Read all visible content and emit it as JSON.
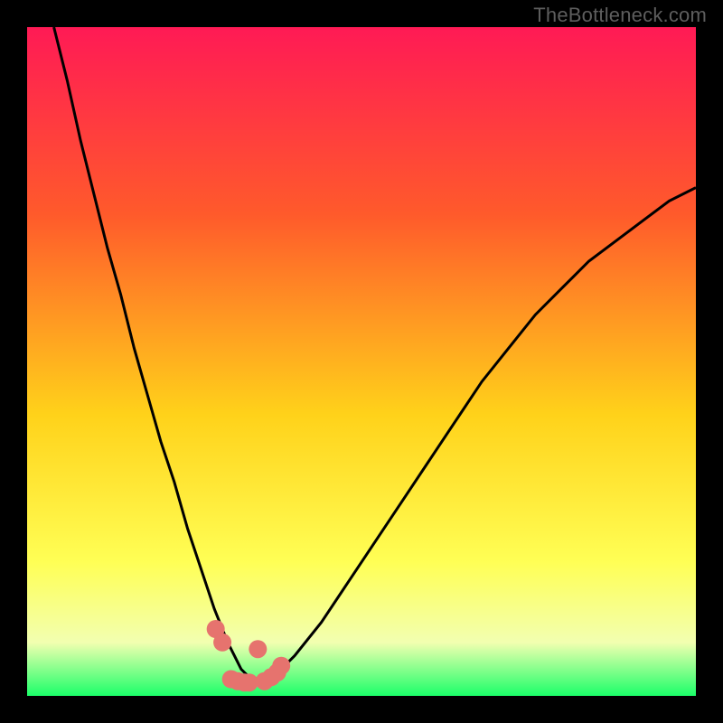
{
  "watermark": "TheBottleneck.com",
  "colors": {
    "frame": "#000000",
    "watermark_text": "#5e5e5e",
    "gradient_top": "#ff1a55",
    "gradient_upper_mid": "#ff5a2b",
    "gradient_mid": "#ffd21a",
    "gradient_lower_mid": "#ffff55",
    "gradient_low": "#f2ffb0",
    "gradient_bottom": "#1bff69",
    "curve": "#000000",
    "dots": "#e6736e"
  },
  "chart_data": {
    "type": "line",
    "title": "",
    "xlabel": "",
    "ylabel": "",
    "xlim": [
      0,
      100
    ],
    "ylim": [
      0,
      100
    ],
    "series": [
      {
        "name": "curve",
        "x": [
          4,
          6,
          8,
          10,
          12,
          14,
          16,
          18,
          20,
          22,
          24,
          26,
          28,
          30,
          31,
          32,
          33,
          34,
          36,
          38,
          40,
          44,
          48,
          52,
          56,
          60,
          64,
          68,
          72,
          76,
          80,
          84,
          88,
          92,
          96,
          100
        ],
        "y": [
          100,
          92,
          83,
          75,
          67,
          60,
          52,
          45,
          38,
          32,
          25,
          19,
          13,
          8,
          6,
          4,
          3,
          2.5,
          3,
          4,
          6,
          11,
          17,
          23,
          29,
          35,
          41,
          47,
          52,
          57,
          61,
          65,
          68,
          71,
          74,
          76
        ]
      },
      {
        "name": "dot-cluster",
        "x": [
          28.2,
          29.2,
          34.5,
          30.5,
          31.5,
          32.5,
          33.2,
          35.5,
          36.5,
          37.4,
          38.0
        ],
        "y": [
          10.0,
          8.0,
          7.0,
          2.5,
          2.2,
          2.0,
          2.0,
          2.2,
          2.8,
          3.5,
          4.5
        ]
      }
    ],
    "annotations": [
      "TheBottleneck.com"
    ]
  }
}
